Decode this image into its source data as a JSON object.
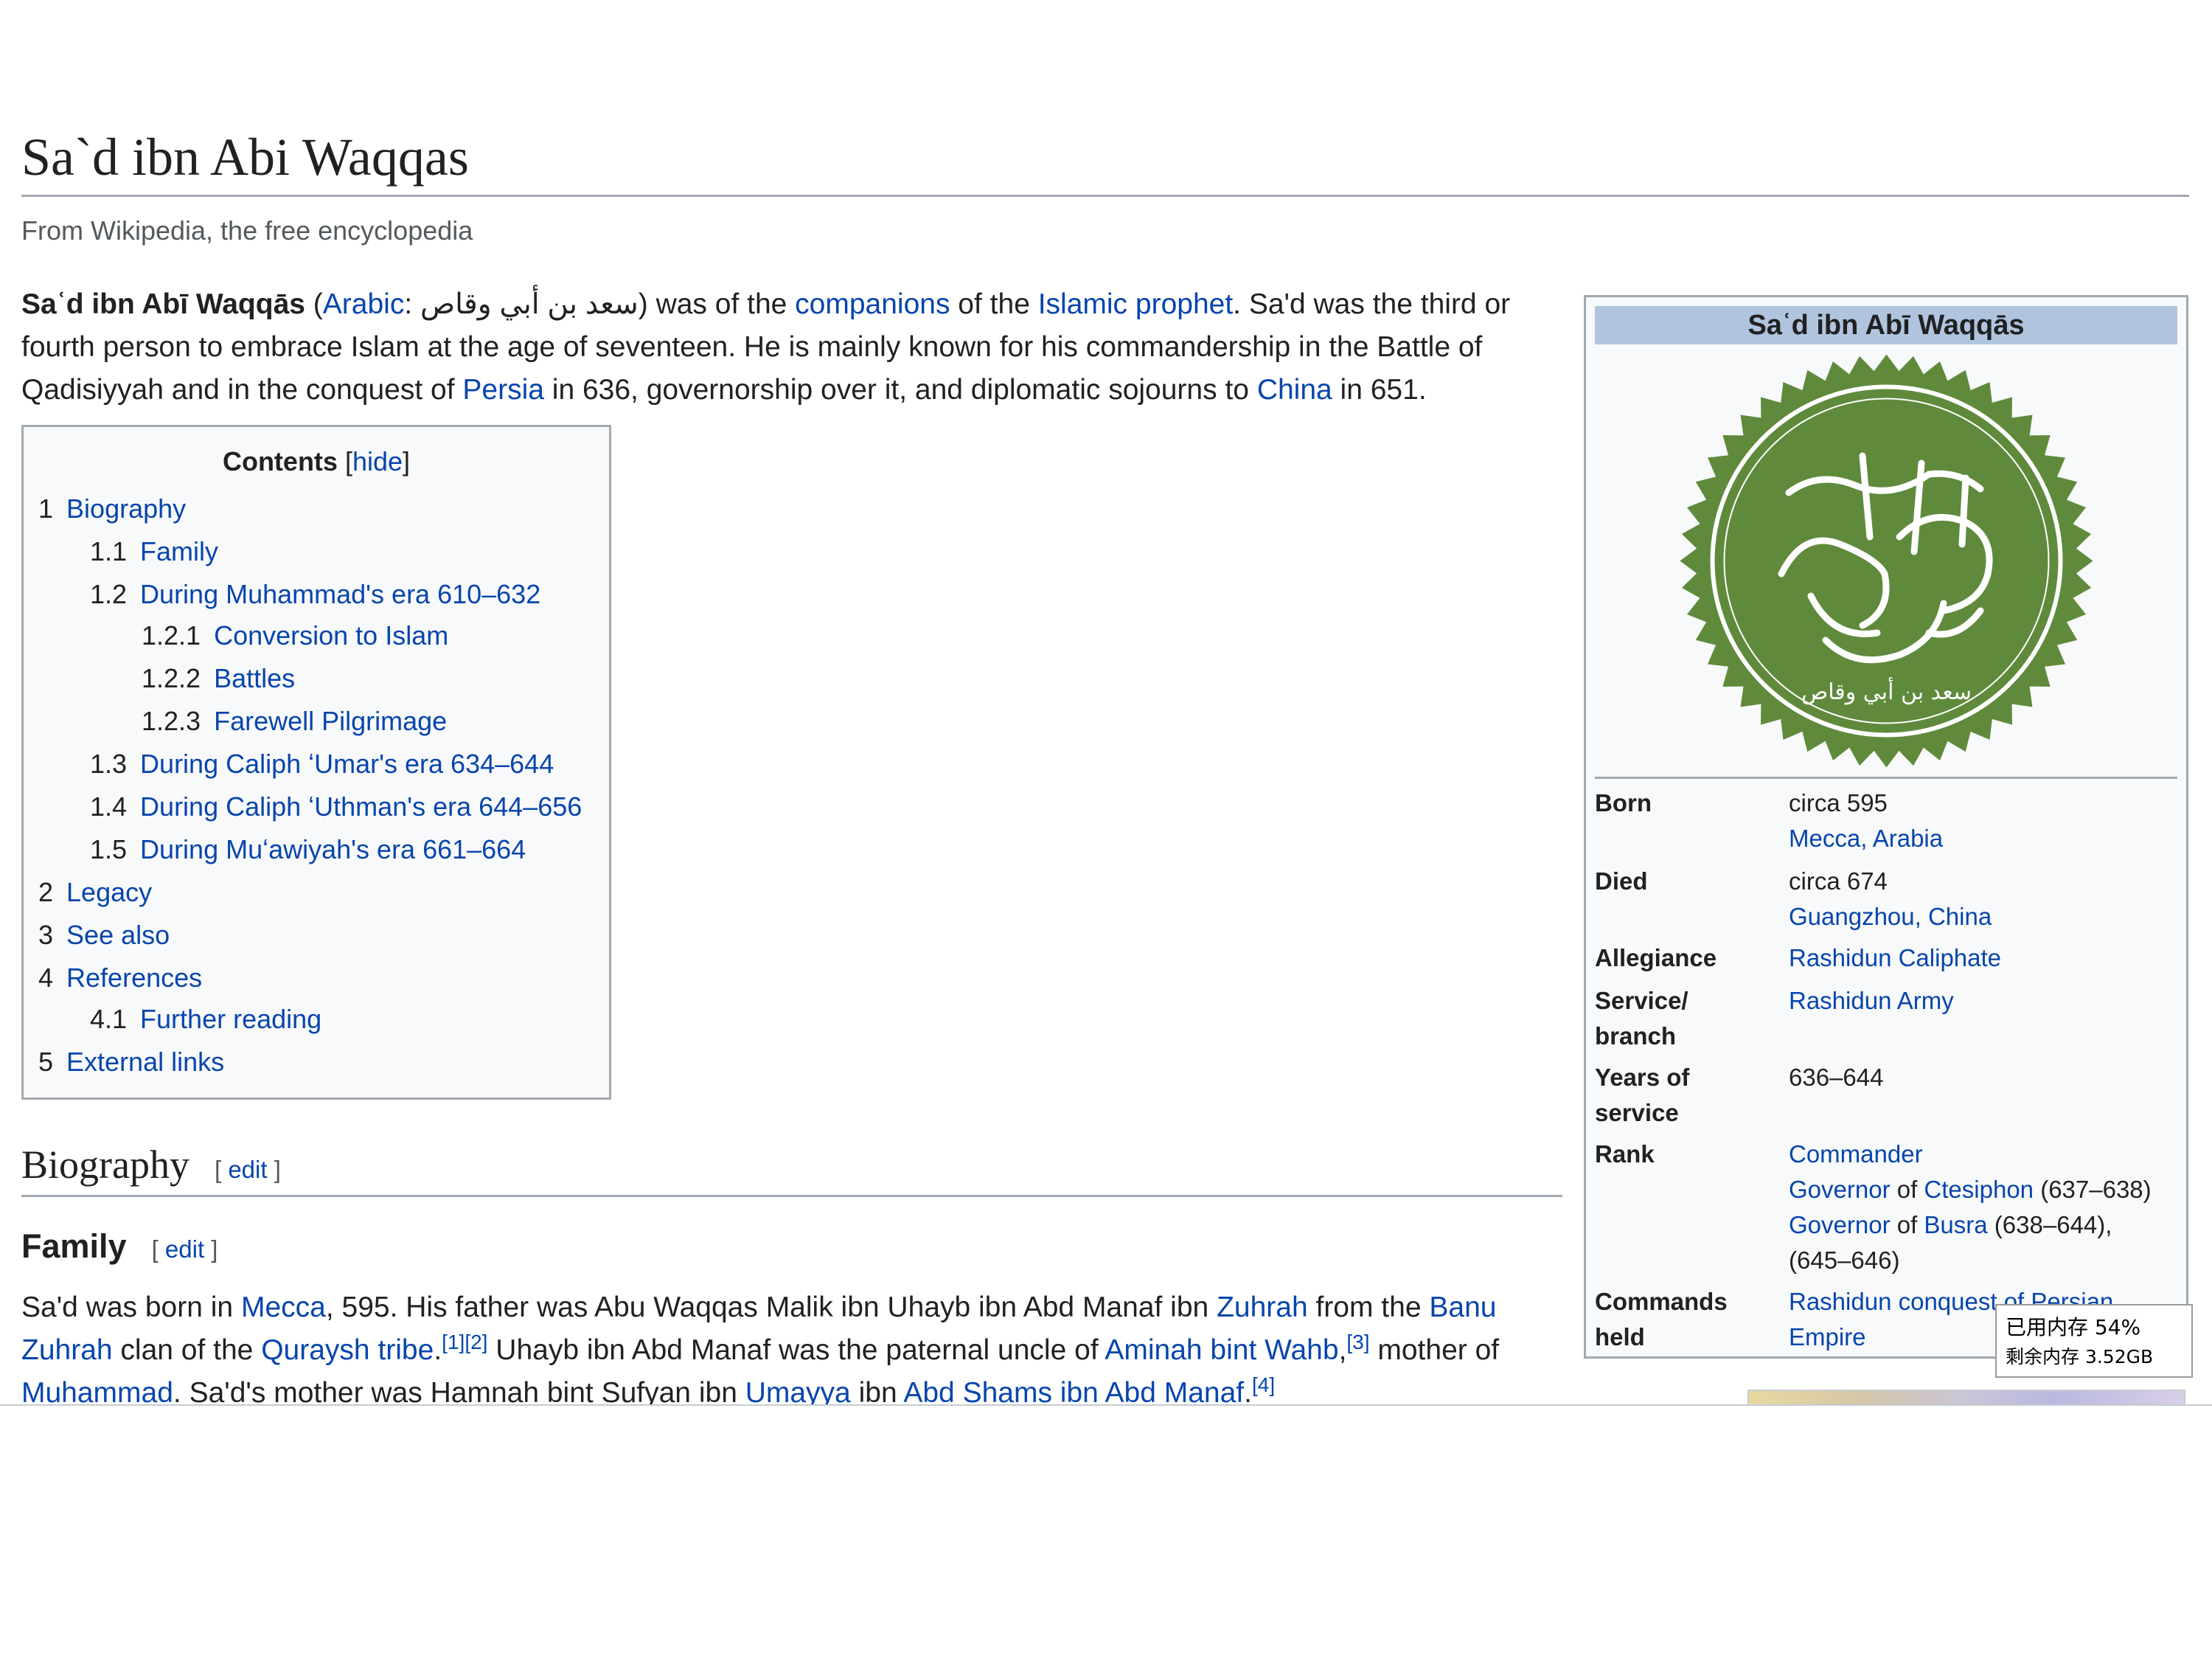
{
  "article": {
    "title": "Sa`d ibn Abi Waqqas",
    "tagline": "From Wikipedia, the free encyclopedia"
  },
  "lead": {
    "name_bold": "Saʿd ibn Abī Waqqās",
    "paren_open": " (",
    "arabic_link": "Arabic",
    "arabic_text": ": سعد بن أبي وقاص",
    "paren_close": ")",
    "t1": " was of the ",
    "link_companions": "companions",
    "t2": " of the ",
    "link_islamic_prophet": "Islamic prophet",
    "t3": ". Sa'd was the third or fourth person to embrace Islam at the age of seventeen. He is mainly known for his commandership in the Battle of Qadisiyyah and in the conquest of ",
    "link_persia": "Persia",
    "t4": " in 636, governorship over it, and diplomatic sojourns to ",
    "link_china": "China",
    "t5": " in 651."
  },
  "toc": {
    "title": "Contents",
    "hide_open": " [",
    "hide_label": "hide",
    "hide_close": "]",
    "items": [
      {
        "num": "1",
        "text": "Biography"
      },
      {
        "num": "1.1",
        "text": "Family"
      },
      {
        "num": "1.2",
        "text": "During Muhammad's era 610–632"
      },
      {
        "num": "1.2.1",
        "text": "Conversion to Islam"
      },
      {
        "num": "1.2.2",
        "text": "Battles"
      },
      {
        "num": "1.2.3",
        "text": "Farewell Pilgrimage"
      },
      {
        "num": "1.3",
        "text": "During Caliph ʻUmar's era 634–644"
      },
      {
        "num": "1.4",
        "text": "During Caliph ʻUthman's era 644–656"
      },
      {
        "num": "1.5",
        "text": "During Muʻawiyah's era 661–664"
      },
      {
        "num": "2",
        "text": "Legacy"
      },
      {
        "num": "3",
        "text": "See also"
      },
      {
        "num": "4",
        "text": "References"
      },
      {
        "num": "4.1",
        "text": "Further reading"
      },
      {
        "num": "5",
        "text": "External links"
      }
    ]
  },
  "sections": {
    "biography": {
      "heading": "Biography",
      "edit_open": "[ ",
      "edit_label": "edit",
      "edit_close": " ]"
    },
    "family": {
      "heading": "Family",
      "edit_open": "[ ",
      "edit_label": "edit",
      "edit_close": " ]"
    }
  },
  "family_para": {
    "t1": "Sa'd was born in ",
    "link_mecca": "Mecca",
    "t2": ", 595. His father was Abu Waqqas Malik ibn Uhayb ibn Abd Manaf ibn ",
    "link_zuhrah": "Zuhrah",
    "t3": " from the ",
    "link_banu_zuhrah": "Banu Zuhrah",
    "t4": " clan of the ",
    "link_quraysh": "Quraysh tribe",
    "t5": ".",
    "ref1": "[1]",
    "ref2": "[2]",
    "t6": " Uhayb ibn Abd Manaf was the paternal uncle of ",
    "link_aminah": "Aminah bint Wahb",
    "t7": ",",
    "ref3": "[3]",
    "t8": " mother of ",
    "link_muhammad": "Muhammad",
    "t9": ". Sa'd's mother was Hamnah bint Sufyan ibn ",
    "link_umayya": "Umayya",
    "t10": " ibn ",
    "link_abd_shams": "Abd Shams ibn Abd Manaf",
    "t11": ".",
    "ref4": "[4]"
  },
  "infobox": {
    "title": "Saʿd ibn Abī Waqqās",
    "seal_text": "سعد بن أبي وقاص",
    "seal_color": "#5f8a3c",
    "rows": {
      "born": {
        "label": "Born",
        "v1": "circa 595",
        "v2": "Mecca, Arabia"
      },
      "died": {
        "label": "Died",
        "v1": "circa 674",
        "v2": "Guangzhou, China"
      },
      "allegiance": {
        "label": "Allegiance",
        "v1": "Rashidun Caliphate"
      },
      "service": {
        "label1": "Service/",
        "label2": "branch",
        "v1": "Rashidun Army"
      },
      "years": {
        "label1": "Years of",
        "label2": "service",
        "v1": "636–644"
      },
      "rank": {
        "label": "Rank",
        "l1": "Commander",
        "l2a": "Governor",
        "l2b": " of ",
        "l2c": "Ctesiphon",
        "l2d": " (637–638)",
        "l3a": "Governor",
        "l3b": " of ",
        "l3c": "Busra",
        "l3d": " (638–644),",
        "l4": "(645–646)"
      },
      "commands": {
        "label1": "Commands",
        "label2": "held",
        "v1": "Rashidun conquest of Persian",
        "v2": "Empire"
      }
    }
  },
  "memory_tooltip": {
    "line1": "已用内存 54%",
    "line2": "剩余内存 3.52GB"
  }
}
